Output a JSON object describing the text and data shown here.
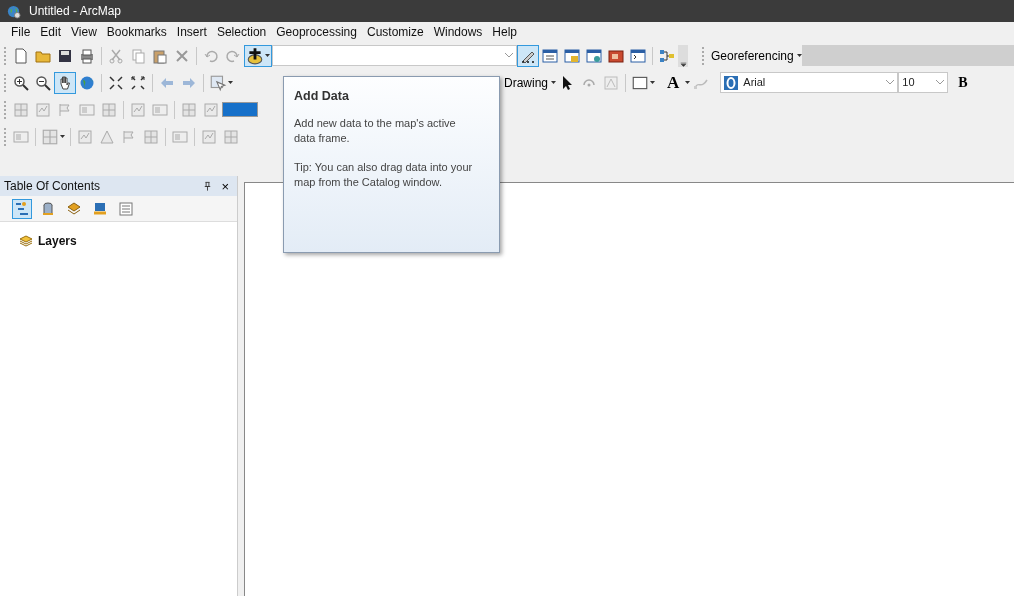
{
  "window": {
    "title": "Untitled - ArcMap"
  },
  "menu": [
    {
      "label": "File"
    },
    {
      "label": "Edit"
    },
    {
      "label": "View"
    },
    {
      "label": "Bookmarks"
    },
    {
      "label": "Insert"
    },
    {
      "label": "Selection"
    },
    {
      "label": "Geoprocessing"
    },
    {
      "label": "Customize"
    },
    {
      "label": "Windows"
    },
    {
      "label": "Help"
    }
  ],
  "toolbars": [
    {
      "segments": [
        {
          "items": [
            {
              "kind": "button",
              "selected": false
            },
            {
              "kind": "button",
              "selected": false
            },
            {
              "kind": "button",
              "selected": false
            },
            {
              "kind": "button",
              "selected": false
            },
            {
              "kind": "separator"
            },
            {
              "kind": "button",
              "selected": false
            },
            {
              "kind": "button",
              "selected": false
            },
            {
              "kind": "button",
              "selected": false
            },
            {
              "kind": "button",
              "selected": false
            },
            {
              "kind": "separator"
            },
            {
              "kind": "button",
              "selected": false
            },
            {
              "kind": "button",
              "selected": false
            },
            {
              "kind": "split",
              "selected": true
            },
            {
              "kind": "combo",
              "disabled": false
            },
            {
              "kind": "button",
              "selected": true
            },
            {
              "kind": "button",
              "selected": false
            },
            {
              "kind": "button",
              "selected": false
            },
            {
              "kind": "button",
              "selected": false
            },
            {
              "kind": "button",
              "selected": false
            },
            {
              "kind": "button",
              "selected": false
            },
            {
              "kind": "separator"
            },
            {
              "kind": "button",
              "selected": false
            },
            {
              "kind": "overflow"
            }
          ]
        },
        {
          "items": [
            {
              "kind": "menu",
              "label": "Georeferencing"
            },
            {
              "kind": "combo",
              "disabled": true
            }
          ]
        }
      ]
    },
    {
      "segments": [
        {
          "items": [
            {
              "kind": "button",
              "selected": false
            },
            {
              "kind": "button",
              "selected": false
            },
            {
              "kind": "button",
              "selected": true
            },
            {
              "kind": "button",
              "selected": false
            },
            {
              "kind": "separator"
            },
            {
              "kind": "button",
              "selected": false
            },
            {
              "kind": "button",
              "selected": false
            },
            {
              "kind": "separator"
            },
            {
              "kind": "button",
              "selected": false
            },
            {
              "kind": "button",
              "selected": false
            },
            {
              "kind": "separator"
            },
            {
              "kind": "split",
              "selected": false
            }
          ]
        },
        {
          "items": [
            {
              "kind": "menu",
              "label": "Drawing"
            },
            {
              "kind": "button",
              "selected": false
            },
            {
              "kind": "button",
              "selected": false
            },
            {
              "kind": "button",
              "selected": false
            },
            {
              "kind": "separator"
            },
            {
              "kind": "split",
              "selected": false
            },
            {
              "kind": "text_split",
              "label": "A"
            },
            {
              "kind": "button",
              "selected": false
            },
            {
              "kind": "font",
              "value": "Arial"
            },
            {
              "kind": "size",
              "value": "10"
            },
            {
              "kind": "bold",
              "label": "B"
            }
          ]
        }
      ]
    },
    {
      "segments": [
        {
          "items": [
            {
              "kind": "button",
              "selected": false
            },
            {
              "kind": "button",
              "selected": false
            },
            {
              "kind": "button",
              "selected": false
            },
            {
              "kind": "button",
              "selected": false
            },
            {
              "kind": "button",
              "selected": false
            },
            {
              "kind": "separator"
            },
            {
              "kind": "button",
              "selected": false
            },
            {
              "kind": "button",
              "selected": false
            },
            {
              "kind": "separator"
            },
            {
              "kind": "button",
              "selected": false
            },
            {
              "kind": "button",
              "selected": false
            },
            {
              "kind": "swatch"
            }
          ]
        }
      ]
    },
    {
      "segments": [
        {
          "items": [
            {
              "kind": "button",
              "selected": false
            },
            {
              "kind": "separator"
            },
            {
              "kind": "split",
              "selected": false
            },
            {
              "kind": "separator"
            },
            {
              "kind": "button",
              "selected": false
            },
            {
              "kind": "button",
              "selected": false
            },
            {
              "kind": "button",
              "selected": false
            },
            {
              "kind": "button",
              "selected": false
            },
            {
              "kind": "separator"
            },
            {
              "kind": "button",
              "selected": false
            },
            {
              "kind": "separator"
            },
            {
              "kind": "button",
              "selected": false
            },
            {
              "kind": "button",
              "selected": false
            }
          ]
        }
      ]
    }
  ],
  "table_of_contents": {
    "title": "Table Of Contents",
    "close": "×",
    "tabs": [
      {
        "selected": true
      },
      {
        "selected": false
      },
      {
        "selected": false
      },
      {
        "selected": false
      },
      {
        "selected": false
      }
    ],
    "tree": [
      {
        "label": "Layers"
      }
    ]
  },
  "tooltip": {
    "title": "Add Data",
    "body": "Add new data to the map's active data frame.",
    "tip": "Tip: You can also drag data into your map from the Catalog window."
  }
}
